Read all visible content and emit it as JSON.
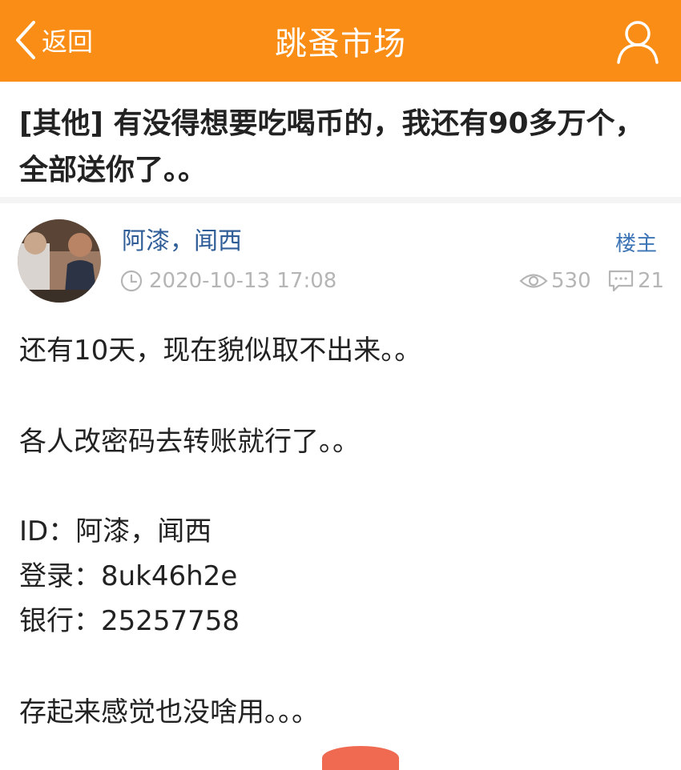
{
  "header": {
    "back_label": "返回",
    "title": "跳蚤市场"
  },
  "post": {
    "title": "[其他] 有没得想要吃喝币的，我还有90多万个，全部送你了。。",
    "author": "阿漆，闻西",
    "op_badge": "楼主",
    "timestamp": "2020-10-13 17:08",
    "views": "530",
    "replies": "21",
    "content": [
      "还有10天，现在貌似取不出来。。",
      "各人改密码去转账就行了。。",
      "ID：阿漆，闻西",
      "登录：8uk46h2e",
      "银行：25257758",
      "存起来感觉也没啥用。。。"
    ]
  },
  "icons": [
    "chevron-left-icon",
    "user-icon",
    "clock-icon",
    "eye-icon",
    "comment-icon"
  ],
  "colors": {
    "header_bg": "#f98d15",
    "author_link": "#2f5d97",
    "meta_gray": "#b5b5b5"
  }
}
